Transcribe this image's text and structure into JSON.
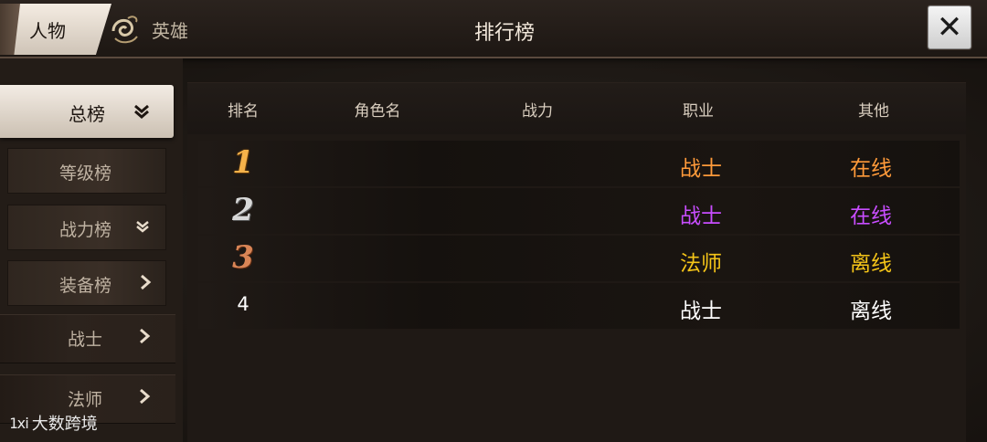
{
  "header": {
    "title": "排行榜",
    "tabs": [
      {
        "label": "人物",
        "active": true
      },
      {
        "label": "英雄",
        "active": false
      }
    ],
    "close_label": "✕"
  },
  "sidebar": {
    "main": {
      "label": "总榜",
      "expanded": true
    },
    "items": [
      {
        "label": "等级榜",
        "chevron": "none"
      },
      {
        "label": "战力榜",
        "chevron": "down"
      },
      {
        "label": "装备榜",
        "chevron": "right"
      },
      {
        "label": "战士",
        "chevron": "right"
      },
      {
        "label": "法师",
        "chevron": "right"
      }
    ]
  },
  "table": {
    "columns": [
      "排名",
      "角色名",
      "战力",
      "职业",
      "其他"
    ],
    "rows": [
      {
        "rank": "1",
        "name": "",
        "power": "",
        "class": "战士",
        "other": "在线",
        "color": "#ff9a3a"
      },
      {
        "rank": "2",
        "name": "",
        "power": "",
        "class": "战士",
        "other": "在线",
        "color": "#c84dff"
      },
      {
        "rank": "3",
        "name": "",
        "power": "",
        "class": "法师",
        "other": "离线",
        "color": "#f5c518"
      },
      {
        "rank": "4",
        "name": "",
        "power": "",
        "class": "战士",
        "other": "离线",
        "color": "#ffffff"
      }
    ]
  },
  "watermark": {
    "logo": "1ⅺ",
    "text": "大数跨境"
  }
}
